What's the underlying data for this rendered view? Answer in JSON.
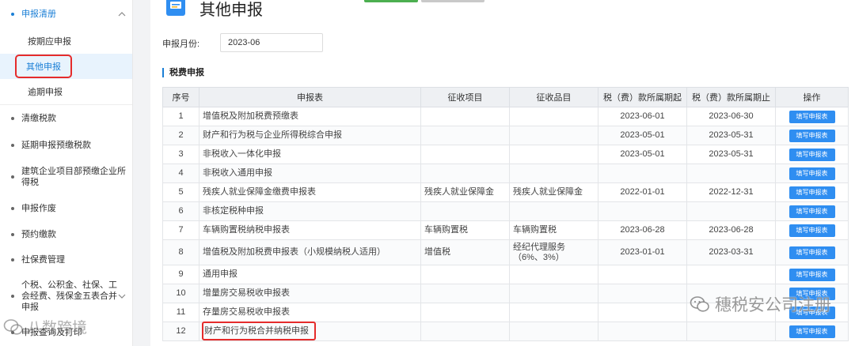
{
  "sidebar": {
    "group_declare": "申报清册",
    "sub_items": [
      "按期应申报",
      "其他申报",
      "逾期申报"
    ],
    "items": [
      {
        "label": "清缴税款"
      },
      {
        "label": "延期申报预缴税款"
      },
      {
        "label": "建筑企业项目部预缴企业所得税"
      },
      {
        "label": "申报作废"
      },
      {
        "label": "预约缴款"
      },
      {
        "label": "社保费管理"
      },
      {
        "label": "个税、公积金、社保、工会经费、残保金五表合并申报"
      },
      {
        "label": "申报查询及打印"
      }
    ]
  },
  "page": {
    "title": "其他申报",
    "month_label": "申报月份:",
    "month_value": "2023-06",
    "section_title": "税费申报"
  },
  "table": {
    "headers": [
      "序号",
      "申报表",
      "征收项目",
      "征收品目",
      "税（费）款所属期起",
      "税（费）款所属期止",
      "操作"
    ],
    "action_label": "填写申报表",
    "rows": [
      {
        "no": "1",
        "form": "增值税及附加税费预缴表",
        "item": "",
        "category": "",
        "start": "2023-06-01",
        "end": "2023-06-30"
      },
      {
        "no": "2",
        "form": "财产和行为税与企业所得税综合申报",
        "item": "",
        "category": "",
        "start": "2023-05-01",
        "end": "2023-05-31"
      },
      {
        "no": "3",
        "form": "非税收入一体化申报",
        "item": "",
        "category": "",
        "start": "2023-05-01",
        "end": "2023-05-31"
      },
      {
        "no": "4",
        "form": "非税收入通用申报",
        "item": "",
        "category": "",
        "start": "",
        "end": ""
      },
      {
        "no": "5",
        "form": "残疾人就业保障金缴费申报表",
        "item": "残疾人就业保障金",
        "category": "残疾人就业保障金",
        "start": "2022-01-01",
        "end": "2022-12-31"
      },
      {
        "no": "6",
        "form": "非核定税种申报",
        "item": "",
        "category": "",
        "start": "",
        "end": ""
      },
      {
        "no": "7",
        "form": "车辆购置税纳税申报表",
        "item": "车辆购置税",
        "category": "车辆购置税",
        "start": "2023-06-28",
        "end": "2023-06-28"
      },
      {
        "no": "8",
        "form": "增值税及附加税费申报表（小规模纳税人适用）",
        "item": "增值税",
        "category": "经纪代理服务（6%、3%）",
        "start": "2023-01-01",
        "end": "2023-03-31"
      },
      {
        "no": "9",
        "form": "通用申报",
        "item": "",
        "category": "",
        "start": "",
        "end": ""
      },
      {
        "no": "10",
        "form": "增量房交易税收申报表",
        "item": "",
        "category": "",
        "start": "",
        "end": ""
      },
      {
        "no": "11",
        "form": "存量房交易税收申报表",
        "item": "",
        "category": "",
        "start": "",
        "end": ""
      },
      {
        "no": "12",
        "form": "财产和行为税合并纳税申报",
        "item": "",
        "category": "",
        "start": "",
        "end": ""
      }
    ]
  },
  "watermarks": {
    "right": "穗税安公司注册",
    "left": "八数跨境"
  },
  "colors": {
    "accent": "#1b7fd6",
    "button": "#2f8ef1",
    "highlight": "#e52b2b"
  }
}
